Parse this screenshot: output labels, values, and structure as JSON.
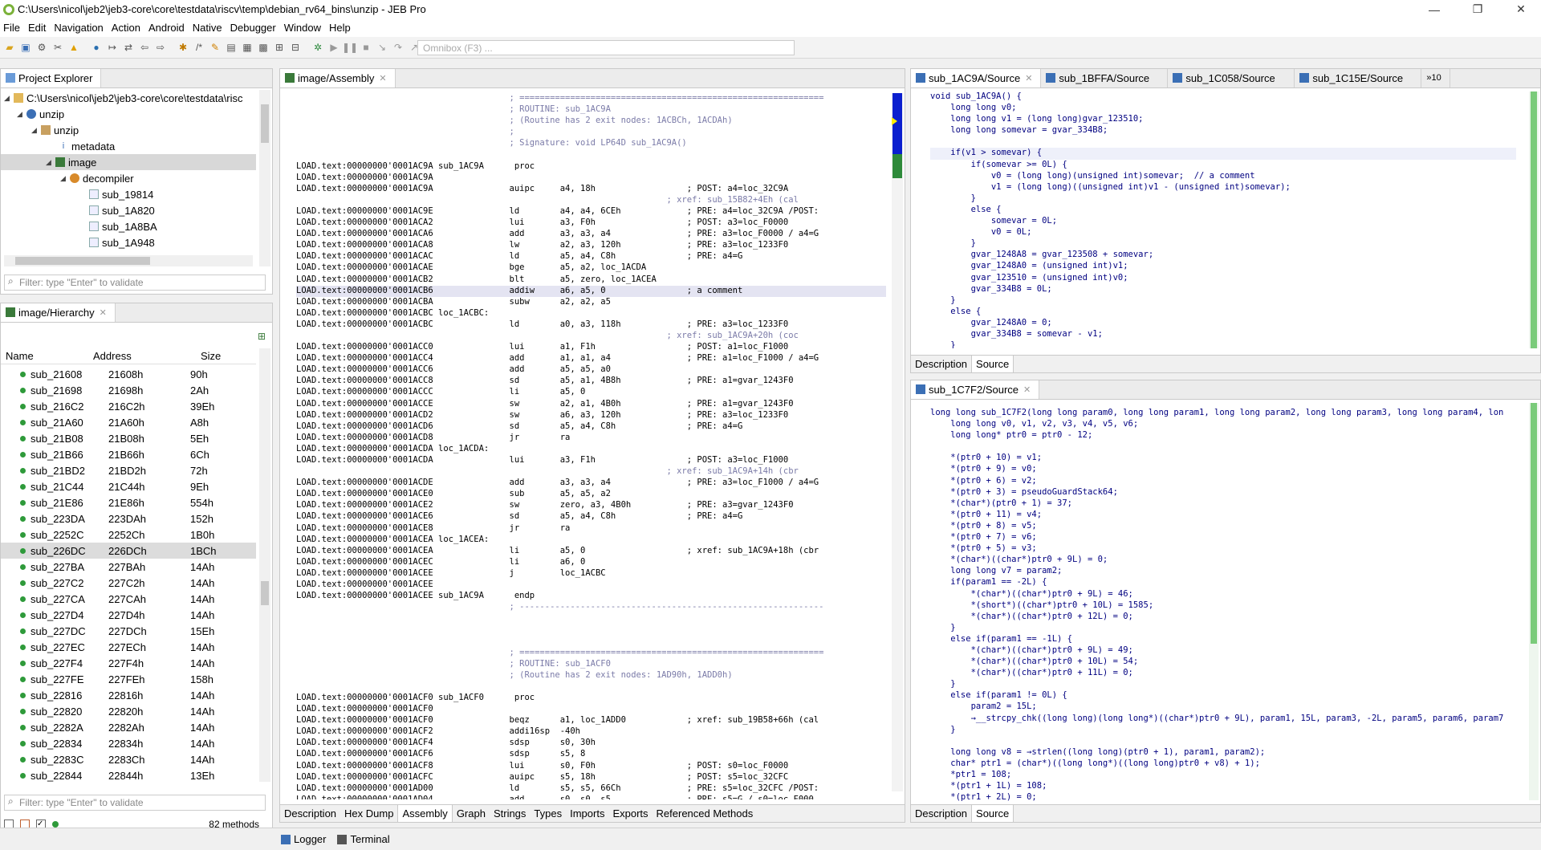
{
  "window": {
    "title": "C:\\Users\\nicol\\jeb2\\jeb3-core\\core\\testdata\\riscv\\temp\\debian_rv64_bins\\unzip - JEB Pro",
    "controls": [
      "—",
      "❐",
      "✕"
    ]
  },
  "menu": [
    "File",
    "Edit",
    "Navigation",
    "Action",
    "Android",
    "Native",
    "Debugger",
    "Window",
    "Help"
  ],
  "toolbar": {
    "omnibox_placeholder": "Omnibox (F3) ..."
  },
  "project_explorer": {
    "tab": "Project Explorer",
    "tree": [
      {
        "label": "C:\\Users\\nicol\\jeb2\\jeb3-core\\core\\testdata\\risc",
        "indent": 0
      },
      {
        "label": "unzip",
        "indent": 1
      },
      {
        "label": "unzip",
        "indent": 2
      },
      {
        "label": "metadata",
        "indent": 3
      },
      {
        "label": "image",
        "indent": 3
      },
      {
        "label": "decompiler",
        "indent": 4
      },
      {
        "label": "sub_19814",
        "indent": 5
      },
      {
        "label": "sub_1A820",
        "indent": 5
      },
      {
        "label": "sub_1A8BA",
        "indent": 5
      },
      {
        "label": "sub_1A948",
        "indent": 5
      }
    ],
    "filter_placeholder": "Filter: type \"Enter\" to validate"
  },
  "hierarchy": {
    "tab": "image/Hierarchy",
    "columns": [
      "Name",
      "Address",
      "Size"
    ],
    "rows": [
      [
        "sub_21608",
        "21608h",
        "90h"
      ],
      [
        "sub_21698",
        "21698h",
        "2Ah"
      ],
      [
        "sub_216C2",
        "216C2h",
        "39Eh"
      ],
      [
        "sub_21A60",
        "21A60h",
        "A8h"
      ],
      [
        "sub_21B08",
        "21B08h",
        "5Eh"
      ],
      [
        "sub_21B66",
        "21B66h",
        "6Ch"
      ],
      [
        "sub_21BD2",
        "21BD2h",
        "72h"
      ],
      [
        "sub_21C44",
        "21C44h",
        "9Eh"
      ],
      [
        "sub_21E86",
        "21E86h",
        "554h"
      ],
      [
        "sub_223DA",
        "223DAh",
        "152h"
      ],
      [
        "sub_2252C",
        "2252Ch",
        "1B0h"
      ],
      [
        "sub_226DC",
        "226DCh",
        "1BCh"
      ],
      [
        "sub_227BA",
        "227BAh",
        "14Ah"
      ],
      [
        "sub_227C2",
        "227C2h",
        "14Ah"
      ],
      [
        "sub_227CA",
        "227CAh",
        "14Ah"
      ],
      [
        "sub_227D4",
        "227D4h",
        "14Ah"
      ],
      [
        "sub_227DC",
        "227DCh",
        "15Eh"
      ],
      [
        "sub_227EC",
        "227ECh",
        "14Ah"
      ],
      [
        "sub_227F4",
        "227F4h",
        "14Ah"
      ],
      [
        "sub_227FE",
        "227FEh",
        "158h"
      ],
      [
        "sub_22816",
        "22816h",
        "14Ah"
      ],
      [
        "sub_22820",
        "22820h",
        "14Ah"
      ],
      [
        "sub_2282A",
        "2282Ah",
        "14Ah"
      ],
      [
        "sub_22834",
        "22834h",
        "14Ah"
      ],
      [
        "sub_2283C",
        "2283Ch",
        "14Ah"
      ],
      [
        "sub_22844",
        "22844h",
        "13Eh"
      ]
    ],
    "filter_placeholder": "Filter: type \"Enter\" to validate",
    "count": "82 methods"
  },
  "assembly": {
    "tab": "image/Assembly",
    "lines": [
      "                                          ; ============================================================",
      "                                          ; ROUTINE: sub_1AC9A",
      "                                          ; (Routine has 2 exit nodes: 1ACBCh, 1ACDAh)",
      "                                          ;",
      "                                          ; Signature: void LP64D sub_1AC9A()",
      "",
      "LOAD.text:00000000'0001AC9A sub_1AC9A      proc",
      "LOAD.text:00000000'0001AC9A",
      "LOAD.text:00000000'0001AC9A               auipc     a4, 18h                  ; POST: a4=loc_32C9A",
      "                                                                         ; xref: sub_15B82+4Eh (cal",
      "LOAD.text:00000000'0001AC9E               ld        a4, a4, 6CEh             ; PRE: a4=loc_32C9A /POST:",
      "LOAD.text:00000000'0001ACA2               lui       a3, F0h                  ; POST: a3=loc_F0000",
      "LOAD.text:00000000'0001ACA6               add       a3, a3, a4               ; PRE: a3=loc_F0000 / a4=G",
      "LOAD.text:00000000'0001ACA8               lw        a2, a3, 120h             ; PRE: a3=loc_1233F0",
      "LOAD.text:00000000'0001ACAC               ld        a5, a4, C8h              ; PRE: a4=G",
      "LOAD.text:00000000'0001ACAE               bge       a5, a2, loc_1ACDA",
      "LOAD.text:00000000'0001ACB2               blt       a5, zero, loc_1ACEA",
      "LOAD.text:00000000'0001ACB6               addiw     a6, a5, 0                ; a comment",
      "LOAD.text:00000000'0001ACBA               subw      a2, a2, a5",
      "LOAD.text:00000000'0001ACBC loc_1ACBC:",
      "LOAD.text:00000000'0001ACBC               ld        a0, a3, 118h             ; PRE: a3=loc_1233F0",
      "                                                                         ; xref: sub_1AC9A+20h (coc",
      "LOAD.text:00000000'0001ACC0               lui       a1, F1h                  ; POST: a1=loc_F1000",
      "LOAD.text:00000000'0001ACC4               add       a1, a1, a4               ; PRE: a1=loc_F1000 / a4=G",
      "LOAD.text:00000000'0001ACC6               add       a5, a5, a0",
      "LOAD.text:00000000'0001ACC8               sd        a5, a1, 4B8h             ; PRE: a1=gvar_1243F0",
      "LOAD.text:00000000'0001ACCC               li        a5, 0",
      "LOAD.text:00000000'0001ACCE               sw        a2, a1, 4B0h             ; PRE: a1=gvar_1243F0",
      "LOAD.text:00000000'0001ACD2               sw        a6, a3, 120h             ; PRE: a3=loc_1233F0",
      "LOAD.text:00000000'0001ACD6               sd        a5, a4, C8h              ; PRE: a4=G",
      "LOAD.text:00000000'0001ACD8               jr        ra",
      "LOAD.text:00000000'0001ACDA loc_1ACDA:",
      "LOAD.text:00000000'0001ACDA               lui       a3, F1h                  ; POST: a3=loc_F1000",
      "                                                                         ; xref: sub_1AC9A+14h (cbr",
      "LOAD.text:00000000'0001ACDE               add       a3, a3, a4               ; PRE: a3=loc_F1000 / a4=G",
      "LOAD.text:00000000'0001ACE0               sub       a5, a5, a2",
      "LOAD.text:00000000'0001ACE2               sw        zero, a3, 4B0h           ; PRE: a3=gvar_1243F0",
      "LOAD.text:00000000'0001ACE6               sd        a5, a4, C8h              ; PRE: a4=G",
      "LOAD.text:00000000'0001ACE8               jr        ra",
      "LOAD.text:00000000'0001ACEA loc_1ACEA:",
      "LOAD.text:00000000'0001ACEA               li        a5, 0                    ; xref: sub_1AC9A+18h (cbr",
      "LOAD.text:00000000'0001ACEC               li        a6, 0",
      "LOAD.text:00000000'0001ACEE               j         loc_1ACBC",
      "LOAD.text:00000000'0001ACEE",
      "LOAD.text:00000000'0001ACEE sub_1AC9A      endp",
      "                                          ; ------------------------------------------------------------",
      "",
      "",
      "",
      "                                          ; ============================================================",
      "                                          ; ROUTINE: sub_1ACF0",
      "                                          ; (Routine has 2 exit nodes: 1AD90h, 1ADD0h)",
      "",
      "LOAD.text:00000000'0001ACF0 sub_1ACF0      proc",
      "LOAD.text:00000000'0001ACF0",
      "LOAD.text:00000000'0001ACF0               beqz      a1, loc_1ADD0            ; xref: sub_19B58+66h (cal",
      "LOAD.text:00000000'0001ACF2               addi16sp  -40h",
      "LOAD.text:00000000'0001ACF4               sdsp      s0, 30h",
      "LOAD.text:00000000'0001ACF6               sdsp      s5, 8",
      "LOAD.text:00000000'0001ACF8               lui       s0, F0h                  ; POST: s0=loc_F0000",
      "LOAD.text:00000000'0001ACFC               auipc     s5, 18h                  ; POST: s5=loc_32CFC",
      "LOAD.text:00000000'0001AD00               ld        s5, s5, 66Ch             ; PRE: s5=loc_32CFC /POST:",
      "LOAD.text:00000000'0001AD04               add       s0, s0, s5               ; PRE: s5=G / s0=loc_F000"
    ],
    "bottom_tabs": [
      "Description",
      "Hex Dump",
      "Assembly",
      "Graph",
      "Strings",
      "Types",
      "Imports",
      "Exports",
      "Referenced Methods"
    ]
  },
  "source_top": {
    "tabs": [
      "sub_1AC9A/Source",
      "sub_1BFFA/Source",
      "sub_1C058/Source",
      "sub_1C15E/Source",
      "»10"
    ],
    "lines": [
      "void sub_1AC9A() {",
      "    long long v0;",
      "    long long v1 = (long long)gvar_123510;",
      "    long long somevar = gvar_334B8;",
      "",
      "    if(v1 > somevar) {",
      "        if(somevar >= 0L) {",
      "            v0 = (long long)(unsigned int)somevar;  // a comment",
      "            v1 = (long long)((unsigned int)v1 - (unsigned int)somevar);",
      "        }",
      "        else {",
      "            somevar = 0L;",
      "            v0 = 0L;",
      "        }",
      "        gvar_1248A8 = gvar_123508 + somevar;",
      "        gvar_1248A0 = (unsigned int)v1;",
      "        gvar_123510 = (unsigned int)v0;",
      "        gvar_334B8 = 0L;",
      "    }",
      "    else {",
      "        gvar_1248A0 = 0;",
      "        gvar_334B8 = somevar - v1;",
      "    }"
    ],
    "bottom_tabs": [
      "Description",
      "Source"
    ]
  },
  "source_bottom": {
    "tab": "sub_1C7F2/Source",
    "lines": [
      "long long sub_1C7F2(long long param0, long long param1, long long param2, long long param3, long long param4, lon",
      "    long long v0, v1, v2, v3, v4, v5, v6;",
      "    long long* ptr0 = ptr0 - 12;",
      "",
      "    *(ptr0 + 10) = v1;",
      "    *(ptr0 + 9) = v0;",
      "    *(ptr0 + 6) = v2;",
      "    *(ptr0 + 3) = pseudoGuardStack64;",
      "    *(char*)(ptr0 + 1) = 37;",
      "    *(ptr0 + 11) = v4;",
      "    *(ptr0 + 8) = v5;",
      "    *(ptr0 + 7) = v6;",
      "    *(ptr0 + 5) = v3;",
      "    *(char*)((char*)ptr0 + 9L) = 0;",
      "    long long v7 = param2;",
      "    if(param1 == -2L) {",
      "        *(char*)((char*)ptr0 + 9L) = 46;",
      "        *(short*)((char*)ptr0 + 10L) = 1585;",
      "        *(char*)((char*)ptr0 + 12L) = 0;",
      "    }",
      "    else if(param1 == -1L) {",
      "        *(char*)((char*)ptr0 + 9L) = 49;",
      "        *(char*)((char*)ptr0 + 10L) = 54;",
      "        *(char*)((char*)ptr0 + 11L) = 0;",
      "    }",
      "    else if(param1 != 0L) {",
      "        param2 = 15L;",
      "        →__strcpy_chk((long long)(long long*)((char*)ptr0 + 9L), param1, 15L, param3, -2L, param5, param6, param7",
      "    }",
      "",
      "    long long v8 = →strlen((long long)(ptr0 + 1), param1, param2);",
      "    char* ptr1 = (char*)((long long*)((long long)ptr0 + v8) + 1);",
      "    *ptr1 = 108;",
      "    *(ptr1 + 1L) = 108;",
      "    *(ptr1 + 2L) = 0;"
    ],
    "bottom_tabs": [
      "Description",
      "Source"
    ]
  },
  "statusbar": {
    "tabs": [
      "Logger",
      "Terminal"
    ]
  }
}
